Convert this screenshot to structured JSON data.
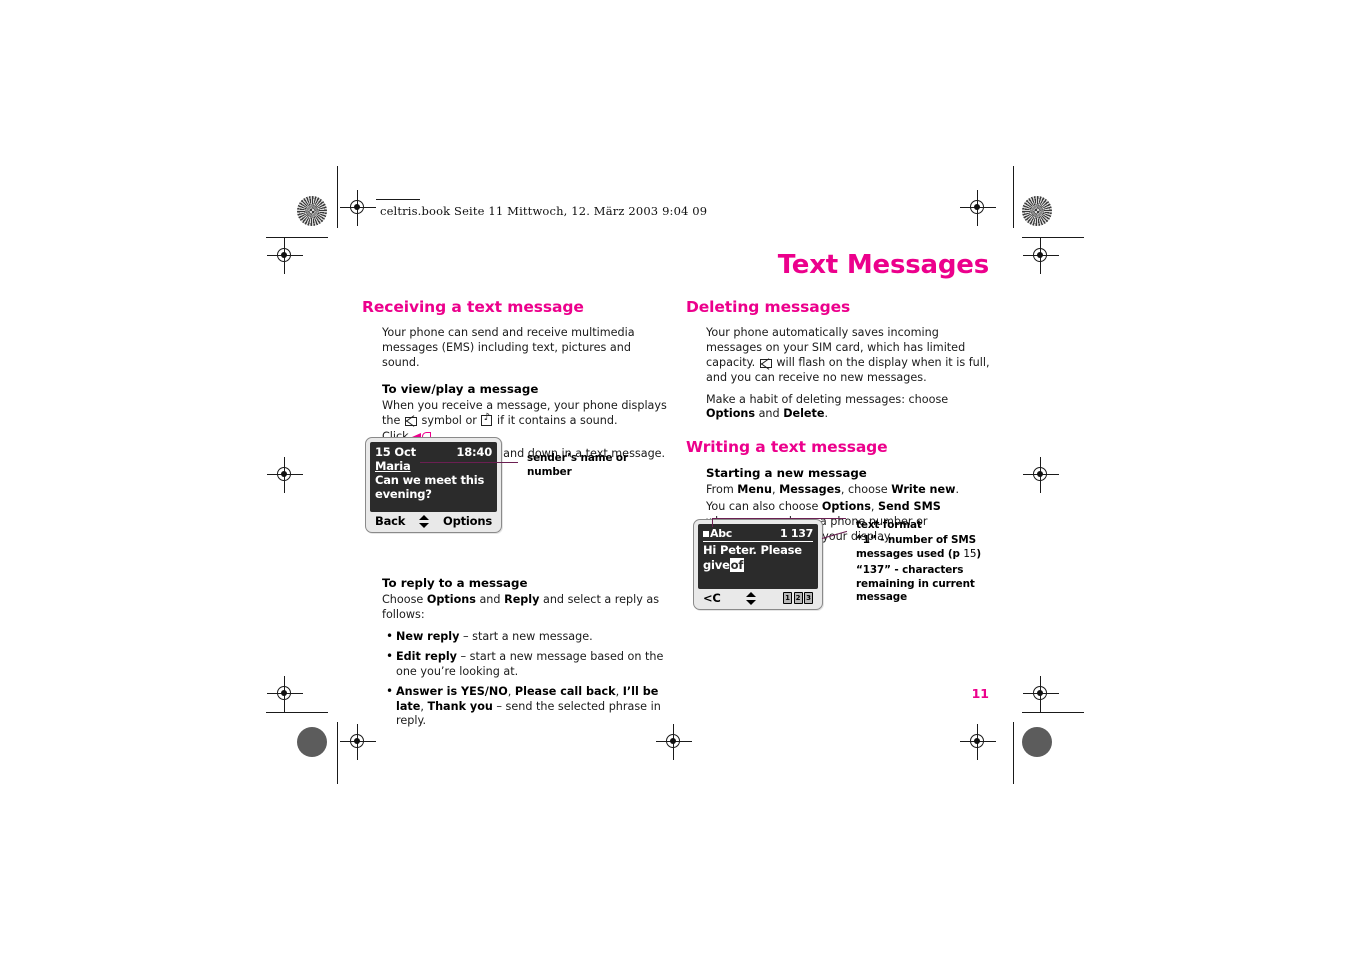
{
  "file_header": {
    "text": "celtris.book  Seite 11  Mittwoch, 12. März 2003  9:04 09"
  },
  "page_title": "Text Messages",
  "page_number": "11",
  "colors": {
    "accent_magenta": "#ec008c",
    "leader_purple": "#6b1f52",
    "screen_dark": "#2b2b2b",
    "bezel_gray": "#e9e9e9"
  },
  "left_column": {
    "section_title": "Receiving a text message",
    "intro": "Your phone can send and receive multimedia messages (EMS) including text, pictures and sound.",
    "sub1_title": "To view/play a message",
    "sub1_p1_a": "When you receive a message, your phone displays the",
    "sub1_p1_b": "symbol or",
    "sub1_p1_c": "if it contains a sound.",
    "click1_label": "Click",
    "click1_end": ".",
    "click2_label": "Click",
    "click2_text": "to move up and down in a text message.",
    "sub2_title": "To reply to a message",
    "sub2_p1_pre": "Choose",
    "sub2_p1_bold1": "Options",
    "sub2_p1_mid": "and",
    "sub2_p1_bold2": "Reply",
    "sub2_p1_post": "and select a reply as follows:",
    "bullets": [
      {
        "bold": "New reply",
        "rest": " – start a new message."
      },
      {
        "bold": "Edit reply",
        "rest": " – start a new message based on the one you’re looking at."
      },
      {
        "bold": "Answer is YES/NO",
        "bold2": "Please call back",
        "bold3": "I’ll be late",
        "bold4": "Thank you",
        "rest": " – send the selected phrase in reply."
      }
    ]
  },
  "right_column": {
    "section_title": "Deleting messages",
    "p1_a": "Your phone automatically saves incoming messages on your SIM card, which has limited capacity.",
    "p1_b": "will flash on the display when it is full, and you can receive no new messages.",
    "p2_pre": "Make a habit of deleting messages: choose",
    "p2_bold1": "Options",
    "p2_mid": "and",
    "p2_bold2": "Delete",
    "p2_post": ".",
    "section_title2": "Writing a text message",
    "sub1_title": "Starting a new message",
    "sub1_p1_pre": "From",
    "sub1_p1_bold1": "Menu",
    "sub1_p1_comma": ",",
    "sub1_p1_bold2": "Messages",
    "sub1_p1_mid": ", choose",
    "sub1_p1_bold3": "Write new",
    "sub1_p1_post": ".",
    "sub1_p2_pre": "You can also choose",
    "sub1_p2_bold1": "Options",
    "sub1_p2_bold2": "Send SMS",
    "sub1_p2_post": "whenever you have a phone number or Phonebook entry on your display."
  },
  "phone_received": {
    "date": "15 Oct",
    "time": "18:40",
    "sender": "Maria",
    "message_line1": "Can we meet this",
    "message_line2": "evening?",
    "softkey_left": "Back",
    "softkey_right": "Options",
    "nav_icon": "up-down-arrows-icon"
  },
  "phone_writing": {
    "format_indicator": "Abc",
    "counter": "1 137",
    "text_line1": "Hi Peter. Please",
    "text_line2_pre": "give",
    "text_line2_selected": "of",
    "softkey_left": "<C",
    "nav_icon": "up-down-arrows-icon",
    "key_icons": [
      "1",
      "2",
      "3"
    ]
  },
  "callouts": {
    "sender_name": "sender’s name or\nnumber",
    "sender_name_l1": "sender’s name or",
    "sender_name_l2": "number",
    "text_format": "text format",
    "sms_count_l1": "“1” - number of SMS",
    "sms_count_l2a": "messages used (p ",
    "sms_count_l2b": "15",
    "sms_count_l2c": ")",
    "chars_l1": "“137” - characters",
    "chars_l2": "remaining in current",
    "chars_l3": "message"
  }
}
